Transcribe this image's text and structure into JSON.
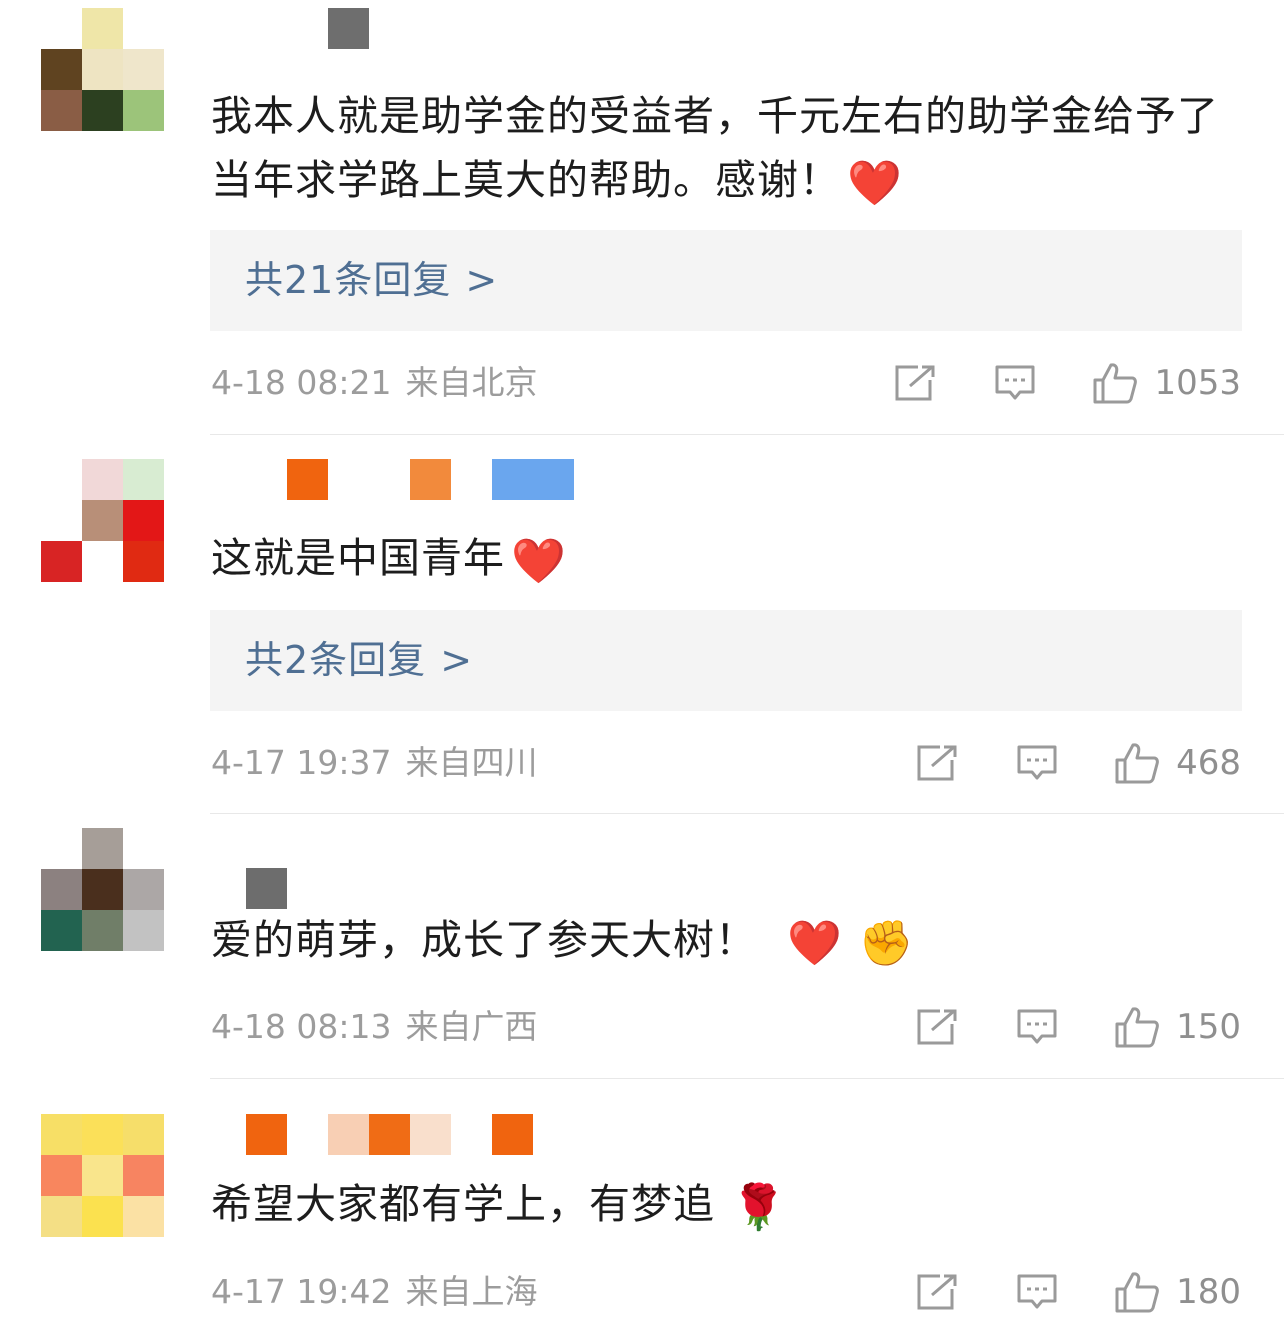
{
  "comments": [
    {
      "text": "我本人就是助学金的受益者，千元左右的助学金给予了当年求学路上莫大的帮助。感谢！",
      "emoji": "❤️",
      "emoji2": "",
      "replies_label": "共21条回复",
      "replies_chevron": ">",
      "time": "4-18 08:21",
      "location": "来自北京",
      "likes": "1053"
    },
    {
      "text": "这就是中国青年",
      "emoji": "❤️",
      "emoji2": "",
      "replies_label": "共2条回复",
      "replies_chevron": ">",
      "time": "4-17 19:37",
      "location": "来自四川",
      "likes": "468"
    },
    {
      "text": "爱的萌芽，成长了参天大树！",
      "emoji": "❤️",
      "emoji2": "✊",
      "time": "4-18 08:13",
      "location": "来自广西",
      "likes": "150"
    },
    {
      "text": "希望大家都有学上，有梦追",
      "emoji": "🌹",
      "emoji2": "",
      "time": "4-17 19:42",
      "location": "来自上海",
      "likes": "180"
    }
  ],
  "icons": {
    "share": "share-icon",
    "reply": "comment-icon",
    "like": "thumbs-up-icon"
  },
  "colors": {
    "reply_link": "#4f6f93",
    "meta": "#9c9c9c",
    "reply_box_bg": "#f4f4f4"
  }
}
